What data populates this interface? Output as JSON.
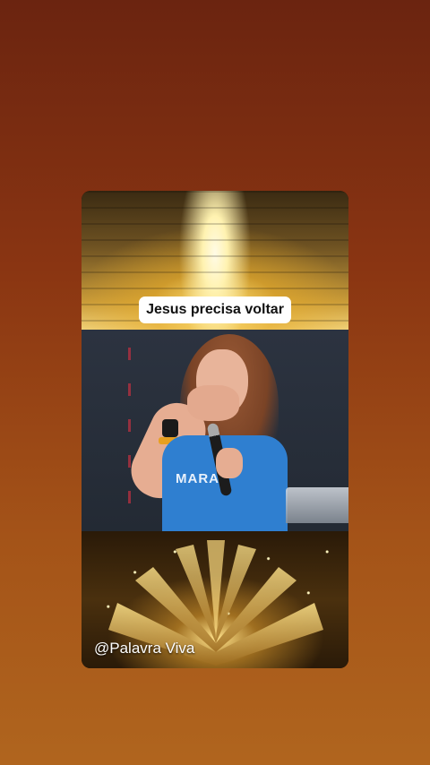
{
  "caption": "Jesus precisa voltar",
  "shirt_text": "MARAN",
  "watermark": "@Palavra Viva",
  "icons": [
    "shining-light-image",
    "book-image"
  ],
  "colors": {
    "background_top": "#6b2410",
    "background_bottom": "#b0651e",
    "caption_bg": "#ffffff",
    "shirt": "#2f7fd0"
  }
}
